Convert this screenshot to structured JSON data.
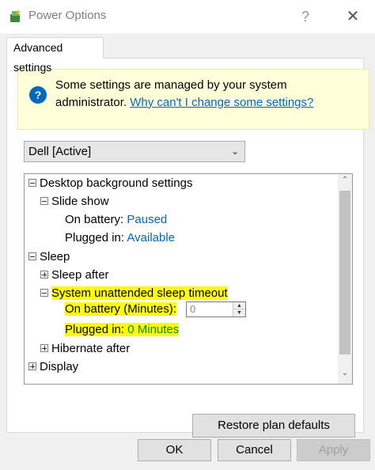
{
  "window": {
    "title": "Power Options",
    "help_glyph": "?",
    "close_glyph": "✕"
  },
  "tab": {
    "label": "Advanced settings"
  },
  "info": {
    "icon_glyph": "?",
    "line1": "Some settings are managed by your system",
    "line2_prefix": "administrator.",
    "link": "Why can't I change some settings?"
  },
  "plan": {
    "selected": "Dell [Active]"
  },
  "tree": {
    "desktop_background": "Desktop background settings",
    "slide_show": "Slide show",
    "slide_on_battery_label": "On battery:",
    "slide_on_battery_value": "Paused",
    "slide_plugged_label": "Plugged in:",
    "slide_plugged_value": "Available",
    "sleep": "Sleep",
    "sleep_after": "Sleep after",
    "unattended": "System unattended sleep timeout",
    "unattended_battery_label": "On battery (Minutes):",
    "unattended_battery_value": "0",
    "unattended_plugged_label": "Plugged in:",
    "unattended_plugged_value": "0 Minutes",
    "hibernate_after": "Hibernate after",
    "display": "Display"
  },
  "buttons": {
    "restore": "Restore plan defaults",
    "ok": "OK",
    "cancel": "Cancel",
    "apply": "Apply"
  },
  "colors": {
    "highlight": "#ffff00",
    "link": "#0066cc",
    "info_bg": "#ffffd9"
  }
}
